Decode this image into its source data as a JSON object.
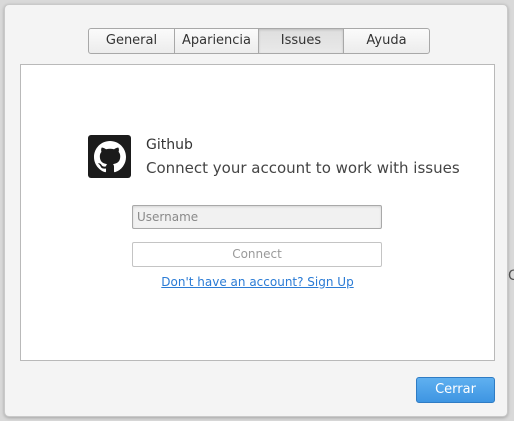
{
  "tabs": [
    {
      "label": "General",
      "active": false
    },
    {
      "label": "Apariencia",
      "active": false
    },
    {
      "label": "Issues",
      "active": true
    },
    {
      "label": "Ayuda",
      "active": false
    }
  ],
  "service": {
    "icon": "github-icon",
    "title": "Github",
    "subtitle": "Connect your account to work with issues"
  },
  "form": {
    "username_placeholder": "Username",
    "username_value": "",
    "connect_label": "Connect",
    "signup_link": "Don't have an account? Sign Up"
  },
  "footer": {
    "close_label": "Cerrar"
  },
  "colors": {
    "accent": "#3e95e2",
    "link": "#2a7bd5"
  }
}
